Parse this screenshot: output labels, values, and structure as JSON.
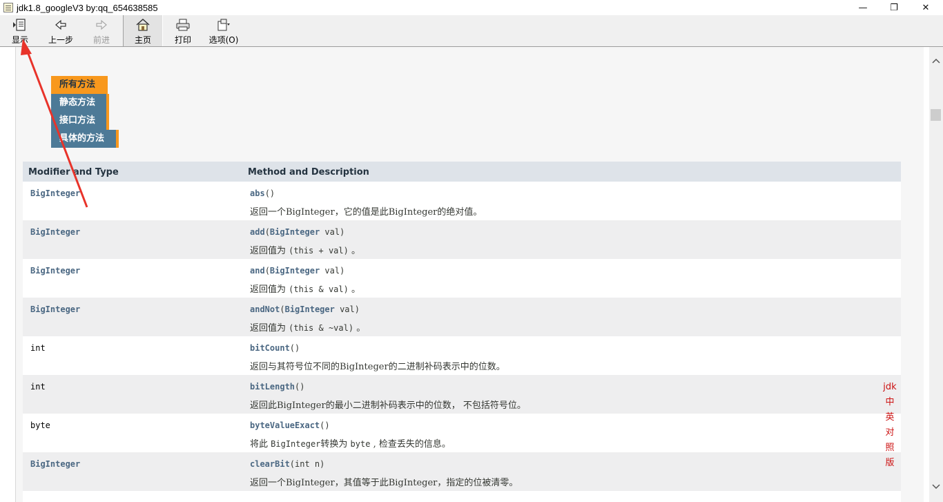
{
  "window": {
    "title": "jdk1.8_googleV3 by:qq_654638585",
    "minimize_glyph": "—",
    "maximize_glyph": "❐",
    "close_glyph": "✕"
  },
  "toolbar": {
    "show_label": "显示",
    "back_label": "上一步",
    "forward_label": "前进",
    "home_label": "主页",
    "print_label": "打印",
    "options_label": "选项(O)"
  },
  "tabs": {
    "all_methods": "所有方法",
    "static_methods": "静态方法",
    "instance_methods": "接口方法",
    "concrete_methods": "具体的方法"
  },
  "table": {
    "col1": "Modifier and Type",
    "col2": "Method and Description",
    "rows": [
      {
        "type": "BigInteger",
        "name": "abs",
        "params": "()",
        "desc": "返回一个BigInteger，它的值是此BigInteger的绝对值。"
      },
      {
        "type": "BigInteger",
        "name": "add",
        "params_open": "(",
        "param_type": "BigInteger",
        "param_rest": " val)",
        "desc_pre": "返回值为 ",
        "desc_code": "(this + val)",
        "desc_post": " 。"
      },
      {
        "type": "BigInteger",
        "name": "and",
        "params_open": "(",
        "param_type": "BigInteger",
        "param_rest": " val)",
        "desc_pre": "返回值为 ",
        "desc_code": "(this & val)",
        "desc_post": " 。"
      },
      {
        "type": "BigInteger",
        "name": "andNot",
        "params_open": "(",
        "param_type": "BigInteger",
        "param_rest": " val)",
        "desc_pre": "返回值为 ",
        "desc_code": "(this & ~val)",
        "desc_post": " 。"
      },
      {
        "type": "int",
        "name": "bitCount",
        "params": "()",
        "desc": "返回与其符号位不同的BigInteger的二进制补码表示中的位数。"
      },
      {
        "type": "int",
        "name": "bitLength",
        "params": "()",
        "desc": "返回此BigInteger的最小二进制补码表示中的位数， 不包括符号位。"
      },
      {
        "type": "byte",
        "name": "byteValueExact",
        "params": "()",
        "desc_pre": "将此 ",
        "desc_code": "BigInteger",
        "desc_mid": "转换为 ",
        "desc_code2": "byte",
        "desc_post": " , 检查丢失的信息。"
      },
      {
        "type": "BigInteger",
        "name": "clearBit",
        "params": "(int n)",
        "desc": "返回一个BigInteger，其值等于此BigInteger，指定的位被清零。"
      }
    ]
  },
  "watermark": [
    "jdk",
    "中",
    "英",
    "对",
    "照",
    "版"
  ],
  "colors": {
    "tab_active": "#f8981d",
    "tab_inactive": "#4d7a97",
    "header_bg": "#dee3e9",
    "link": "#4a6782",
    "watermark": "#cc1111",
    "arrow": "#e8332a"
  }
}
